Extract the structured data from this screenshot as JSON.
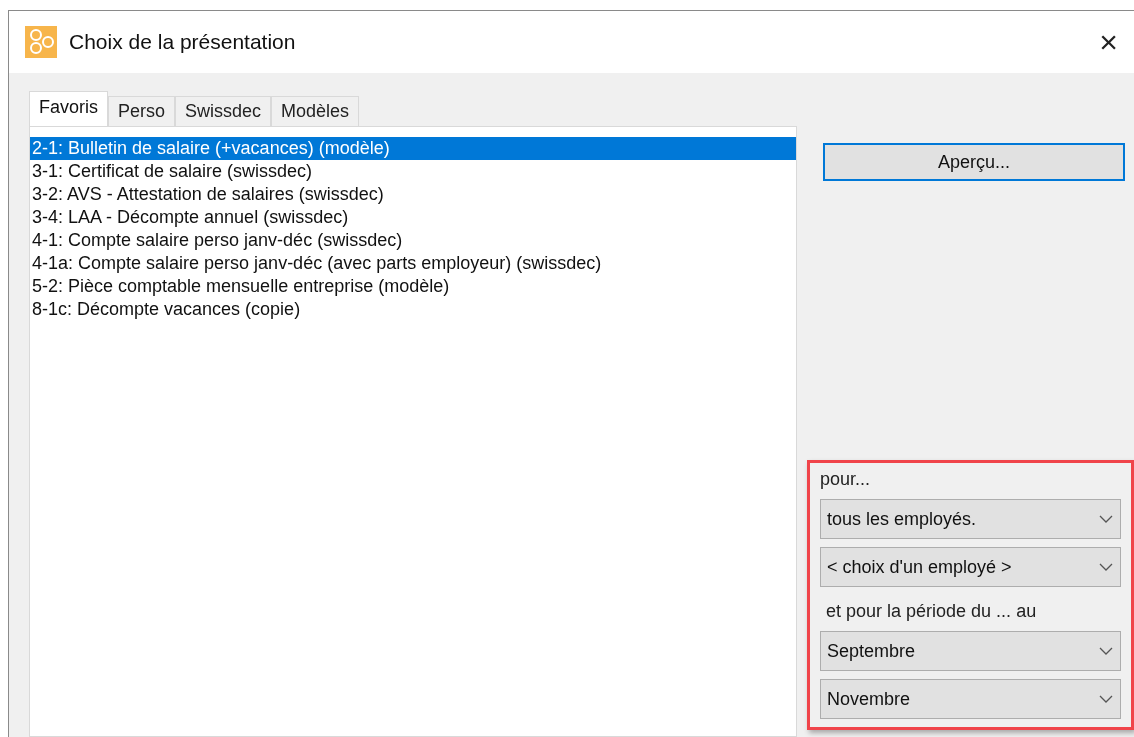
{
  "window": {
    "title": "Choix de la présentation",
    "close": "×"
  },
  "tabs": [
    {
      "label": "Favoris",
      "selected": true
    },
    {
      "label": "Perso",
      "selected": false
    },
    {
      "label": "Swissdec",
      "selected": false
    },
    {
      "label": "Modèles",
      "selected": false
    }
  ],
  "list": [
    {
      "label": "2-1: Bulletin de salaire (+vacances) (modèle)",
      "selected": true
    },
    {
      "label": "3-1: Certificat de salaire (swissdec)",
      "selected": false
    },
    {
      "label": "3-2: AVS - Attestation de salaires (swissdec)",
      "selected": false
    },
    {
      "label": "3-4: LAA - Décompte annuel (swissdec)",
      "selected": false
    },
    {
      "label": "4-1: Compte salaire perso janv-déc (swissdec)",
      "selected": false
    },
    {
      "label": "4-1a: Compte salaire perso janv-déc (avec parts employeur) (swissdec)",
      "selected": false
    },
    {
      "label": "5-2: Pièce comptable mensuelle entreprise (modèle)",
      "selected": false
    },
    {
      "label": "8-1c: Décompte vacances (copie)",
      "selected": false
    }
  ],
  "preview_button": "Aperçu...",
  "filters": [
    {
      "kind": "label",
      "text": "pour..."
    },
    {
      "kind": "select",
      "text": "tous les employés."
    },
    {
      "kind": "select",
      "text": "< choix d'un employé >"
    },
    {
      "kind": "label",
      "text": "et pour la période du ... au"
    },
    {
      "kind": "select",
      "text": "Septembre"
    },
    {
      "kind": "select",
      "text": "Novembre"
    }
  ]
}
